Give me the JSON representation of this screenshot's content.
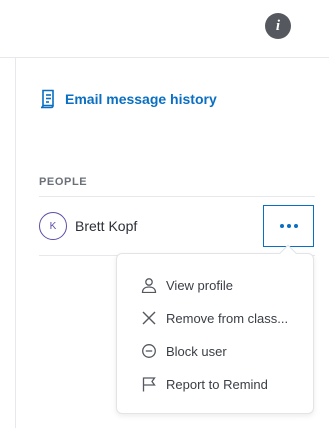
{
  "header": {
    "info_icon": "info-icon",
    "info_glyph": "i"
  },
  "links": {
    "email_history": {
      "label": "Email message history",
      "icon": "document-icon"
    }
  },
  "people": {
    "section_label": "PEOPLE",
    "members": [
      {
        "initial": "K",
        "name": "Brett Kopf"
      }
    ],
    "more_icon": "ellipsis-icon"
  },
  "menu": {
    "items": [
      {
        "label": "View profile",
        "icon": "person-icon"
      },
      {
        "label": "Remove from class...",
        "icon": "close-icon"
      },
      {
        "label": "Block user",
        "icon": "block-icon"
      },
      {
        "label": "Report to Remind",
        "icon": "flag-icon"
      }
    ]
  },
  "colors": {
    "accent": "#0a6fc2",
    "avatar_border": "#5b4fa8",
    "info_bg": "#55595f",
    "divider": "#e6e8eb"
  }
}
